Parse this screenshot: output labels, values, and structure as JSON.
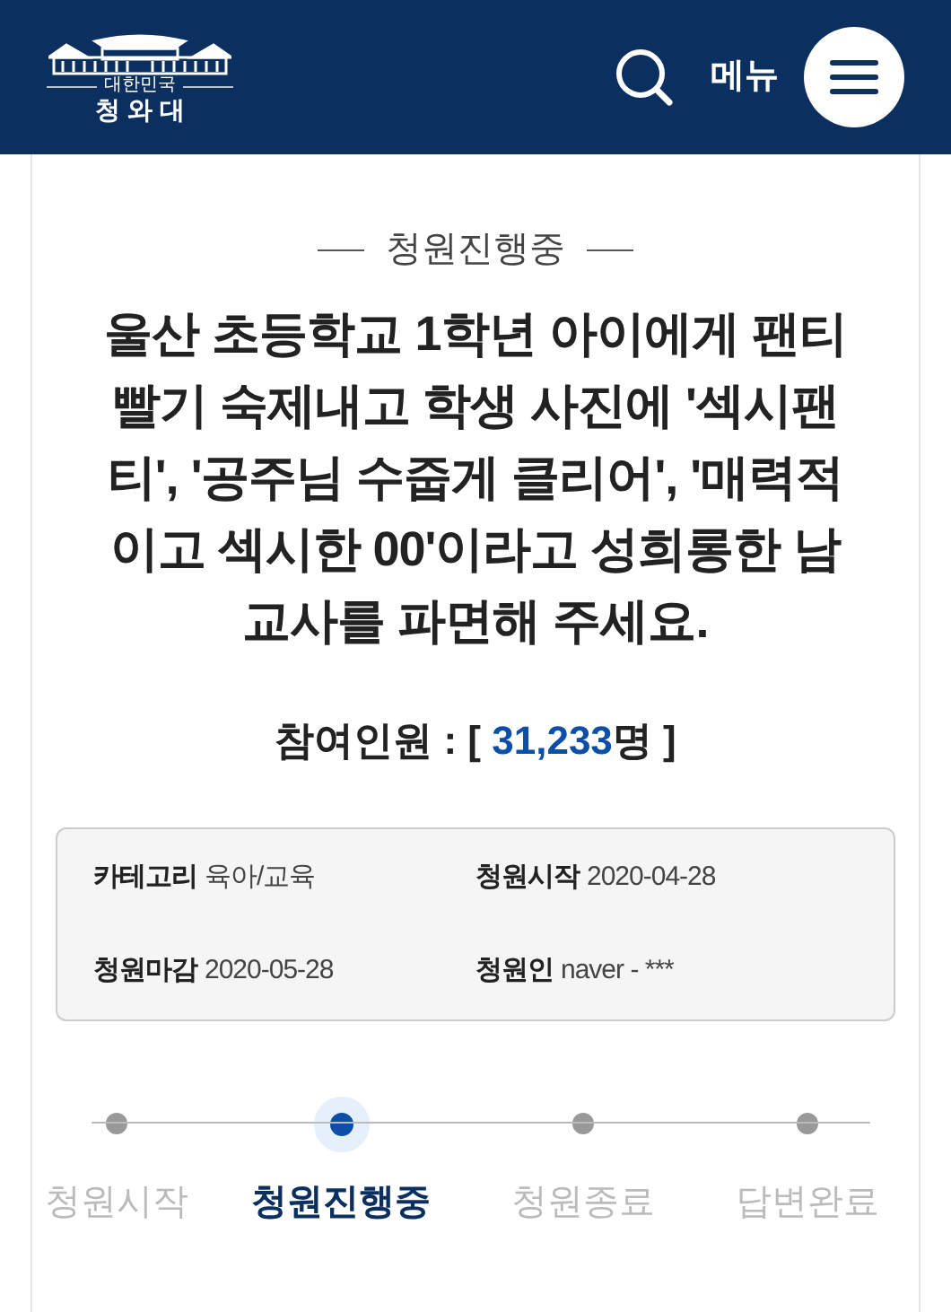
{
  "header": {
    "logo": {
      "subtitle": "대한민국",
      "name": "청 와 대"
    },
    "menu_label": "메뉴"
  },
  "status": "청원진행중",
  "title": "울산 초등학교 1학년 아이에게 팬티\n빨기 숙제내고 학생 사진에 '섹시팬\n티', '공주님 수줍게 클리어', '매력적\n이고 섹시한 00'이라고 성희롱한 남\n교사를 파면해 주세요.",
  "participants": {
    "label": "참여인원 : [",
    "count": "31,233",
    "unit": "명 ]"
  },
  "info": [
    {
      "label": "카테고리",
      "value": "육아/교육"
    },
    {
      "label": "청원시작",
      "value": "2020-04-28"
    },
    {
      "label": "청원마감",
      "value": "2020-05-28"
    },
    {
      "label": "청원인",
      "value": "naver - ***"
    }
  ],
  "steps": [
    {
      "label": "청원시작",
      "selected": false
    },
    {
      "label": "청원진행중",
      "selected": true
    },
    {
      "label": "청원종료",
      "selected": false
    },
    {
      "label": "답변완료",
      "selected": false
    }
  ]
}
